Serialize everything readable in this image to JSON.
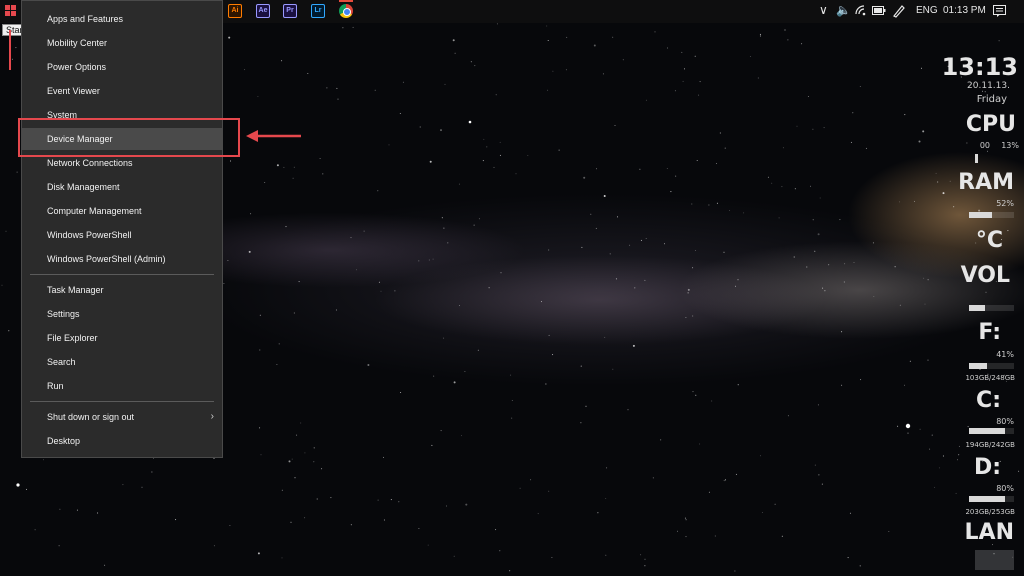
{
  "taskbar": {
    "start_tooltip": "Start",
    "apps": [
      {
        "name": "Illustrator",
        "abbr": "Ai",
        "color": "#ff7c00"
      },
      {
        "name": "After Effects",
        "abbr": "Ae",
        "color": "#9999ff"
      },
      {
        "name": "Premiere Pro",
        "abbr": "Pr",
        "color": "#9999ff"
      },
      {
        "name": "Lightroom",
        "abbr": "Lr",
        "color": "#31a8ff"
      },
      {
        "name": "Chrome",
        "abbr": "",
        "color": "#db4437"
      }
    ],
    "tray": {
      "language": "ENG",
      "time": "01:13 PM"
    }
  },
  "winx_menu": {
    "group1": [
      "Apps and Features",
      "Mobility Center",
      "Power Options",
      "Event Viewer",
      "System",
      "Device Manager",
      "Network Connections",
      "Disk Management",
      "Computer Management",
      "Windows PowerShell",
      "Windows PowerShell (Admin)"
    ],
    "group2": [
      "Task Manager",
      "Settings",
      "File Explorer",
      "Search",
      "Run"
    ],
    "group3": [
      "Shut down or sign out",
      "Desktop"
    ],
    "highlighted_item": "Device Manager"
  },
  "annotation_color": "#e5484d",
  "rainmeter": {
    "clock": {
      "time": "13:13",
      "date": "20.11.13.",
      "day": "Friday"
    },
    "cpu": {
      "label": "CPU",
      "core0": "00",
      "percent": "13%",
      "fraction": 0.13
    },
    "ram": {
      "label": "RAM",
      "percent": "52%",
      "fraction": 0.52
    },
    "temp": {
      "label": "°C"
    },
    "vol": {
      "label": "VOL",
      "fraction": 0.35
    },
    "drive_f": {
      "label": "F:",
      "percent": "41%",
      "usage": "103GB/248GB",
      "fraction": 0.41
    },
    "drive_c": {
      "label": "C:",
      "percent": "80%",
      "usage": "194GB/242GB",
      "fraction": 0.8
    },
    "drive_d": {
      "label": "D:",
      "percent": "80%",
      "usage": "203GB/253GB",
      "fraction": 0.8
    },
    "lan": {
      "label": "LAN"
    }
  }
}
